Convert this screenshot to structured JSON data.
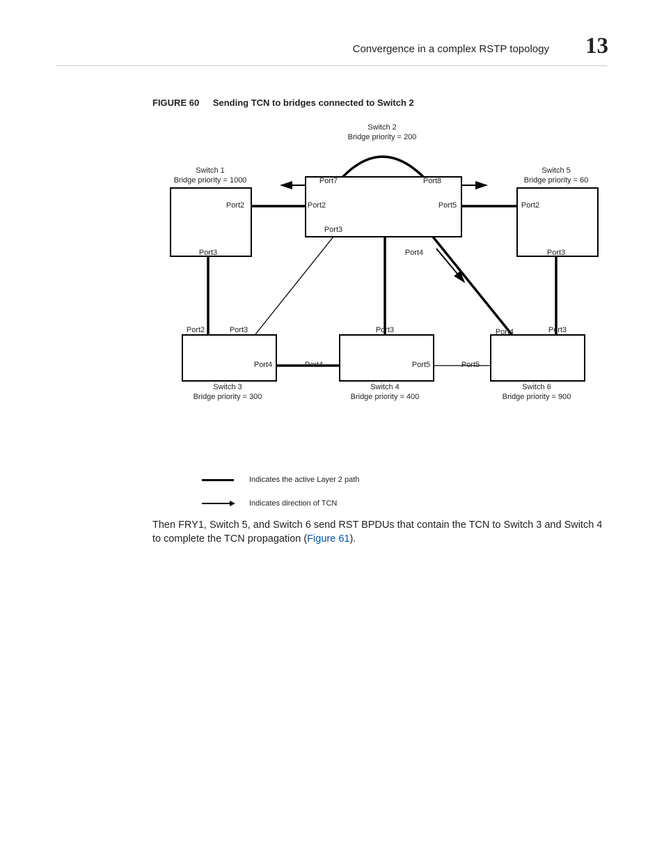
{
  "header": {
    "section_title": "Convergence in a complex RSTP topology",
    "chapter_number": "13"
  },
  "figure": {
    "label": "FIGURE 60",
    "title": "Sending TCN to bridges connected to Switch 2"
  },
  "diagram": {
    "switches": {
      "s1": {
        "name": "Switch 1",
        "priority": "Bridge priority = 1000"
      },
      "s2": {
        "name": "Switch 2",
        "priority": "Bridge priority = 200"
      },
      "s3": {
        "name": "Switch 3",
        "priority": "Bridge priority = 300"
      },
      "s4": {
        "name": "Switch 4",
        "priority": "Bridge priority = 400"
      },
      "s5": {
        "name": "Switch 5",
        "priority": "Bridge priority = 60"
      },
      "s6": {
        "name": "Switch 6",
        "priority": "Bridge priority = 900"
      }
    },
    "ports": {
      "s2_port7": "Port7",
      "s2_port8": "Port8",
      "s2_port5": "Port5",
      "s2_port2l": "Port2",
      "s2_port3": "Port3",
      "s2_port4": "Port4",
      "s1_port2": "Port2",
      "s1_port3": "Port3",
      "s5_port2": "Port2",
      "s5_port3": "Port3",
      "s3_port2": "Port2",
      "s3_port3": "Port3",
      "s3_port4": "Port4",
      "s4_port3": "Port3",
      "s4_port4": "Port4",
      "s4_port5": "Port5",
      "s6_port3": "Port3",
      "s6_port4": "Port4",
      "s6_port5": "Port5"
    }
  },
  "legend": {
    "active_path": "Indicates the active Layer 2 path",
    "direction": "Indicates direction of TCN"
  },
  "body": {
    "para_1a": "Then FRY1, Switch 5, and Switch 6 send RST BPDUs that contain the TCN to Switch 3 and Switch 4 to complete the TCN propagation (",
    "xref": "Figure 61",
    "para_1b": ")."
  }
}
